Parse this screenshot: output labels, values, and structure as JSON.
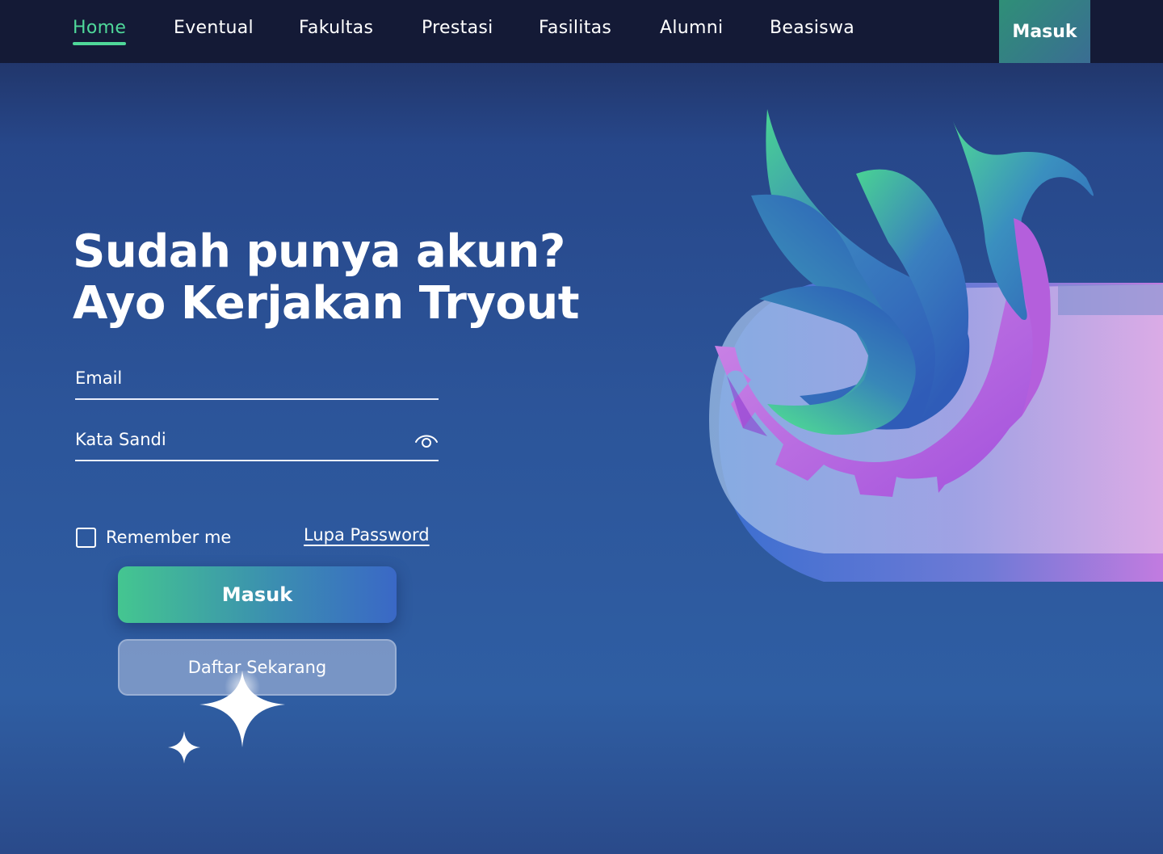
{
  "nav": {
    "items": [
      {
        "label": "Home",
        "active": true
      },
      {
        "label": "Eventual",
        "active": false
      },
      {
        "label": "Fakultas",
        "active": false
      },
      {
        "label": "Prestasi",
        "active": false
      },
      {
        "label": "Fasilitas",
        "active": false
      },
      {
        "label": "Alumni",
        "active": false
      },
      {
        "label": "Beasiswa",
        "active": false
      }
    ],
    "login_label": "Masuk"
  },
  "hero": {
    "title_line1": "Sudah punya akun?",
    "title_line2": "Ayo Kerjakan Tryout"
  },
  "form": {
    "email_placeholder": "Email",
    "password_placeholder": "Kata Sandi",
    "remember_label": "Remember me",
    "remember_checked": false,
    "forgot_label": "Lupa Password",
    "submit_label": "Masuk",
    "register_label": "Daftar Sekarang"
  },
  "icons": {
    "password_toggle": "eye-icon",
    "decoration": "sparkle-icon"
  },
  "colors": {
    "accent_green": "#4fd89a",
    "nav_bg": "#141a36",
    "button_gradient_start": "#44c690",
    "button_gradient_end": "#3a68c6",
    "logo_purple": "#b56ae0"
  }
}
